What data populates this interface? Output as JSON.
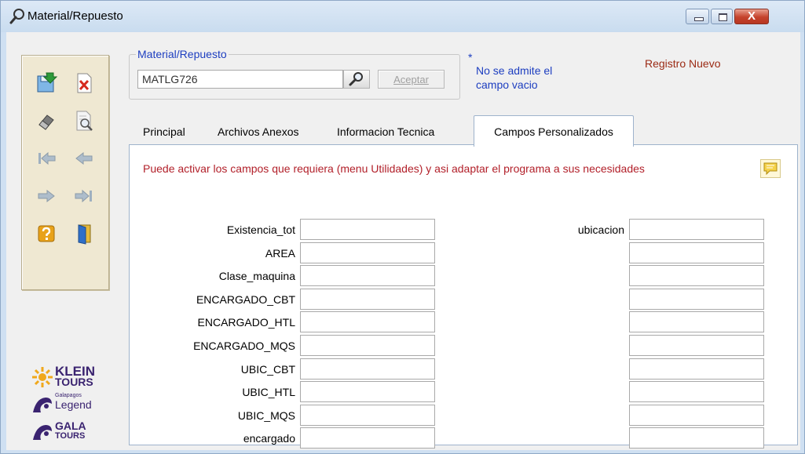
{
  "window": {
    "title": "Material/Repuesto",
    "close_glyph": "X"
  },
  "material": {
    "legend": "Material/Repuesto",
    "value": "MATLG726",
    "accept_label": "Aceptar"
  },
  "note": {
    "asterisk": "*",
    "text": "No se admite el campo vacio"
  },
  "status": "Registro Nuevo",
  "tabs": [
    "Principal",
    "Archivos Anexos",
    "Informacion Tecnica",
    "Campos Personalizados"
  ],
  "panel": {
    "message": "Puede activar los campos que requiera (menu Utilidades) y asi adaptar el programa a sus necesidades",
    "left_fields": [
      {
        "label": "Existencia_tot",
        "value": ""
      },
      {
        "label": "AREA",
        "value": ""
      },
      {
        "label": "Clase_maquina",
        "value": ""
      },
      {
        "label": "ENCARGADO_CBT",
        "value": ""
      },
      {
        "label": "ENCARGADO_HTL",
        "value": ""
      },
      {
        "label": "ENCARGADO_MQS",
        "value": ""
      },
      {
        "label": "UBIC_CBT",
        "value": ""
      },
      {
        "label": "UBIC_HTL",
        "value": ""
      },
      {
        "label": "UBIC_MQS",
        "value": ""
      },
      {
        "label": "encargado",
        "value": ""
      }
    ],
    "right_fields": [
      {
        "label": "ubicacion",
        "value": ""
      },
      {
        "label": "",
        "value": ""
      },
      {
        "label": "",
        "value": ""
      },
      {
        "label": "",
        "value": ""
      },
      {
        "label": "",
        "value": ""
      },
      {
        "label": "",
        "value": ""
      },
      {
        "label": "",
        "value": ""
      },
      {
        "label": "",
        "value": ""
      },
      {
        "label": "",
        "value": ""
      },
      {
        "label": "",
        "value": ""
      }
    ]
  },
  "toolbar": {
    "buttons": [
      {
        "name": "save-icon",
        "color": "#2e9a3a"
      },
      {
        "name": "cancel-icon",
        "color": "#d62a1e"
      },
      {
        "name": "eraser-icon",
        "color": "#6b6b6b"
      },
      {
        "name": "preview-icon",
        "color": "#7a7a7a"
      },
      {
        "name": "first-record-icon",
        "color": "#9fb0c0"
      },
      {
        "name": "previous-record-icon",
        "color": "#9fb0c0"
      },
      {
        "name": "next-record-icon",
        "color": "#9fb0c0"
      },
      {
        "name": "last-record-icon",
        "color": "#9fb0c0"
      },
      {
        "name": "help-icon",
        "color": "#e8a21a"
      },
      {
        "name": "exit-icon",
        "color": "#2f6fc8"
      }
    ]
  },
  "logos": {
    "klein_line1": "KLEIN",
    "klein_line2": "TOURS",
    "legend_line1": "Galapagos",
    "legend_line2": "Legend",
    "gala_line1": "GALA",
    "gala_line2": "TOURS"
  },
  "colors": {
    "accent_blue": "#1d3ec0",
    "message_red": "#b2202a",
    "status_brown": "#9b2a14",
    "logo_purple": "#3a2370",
    "logo_orange": "#f0a81c"
  }
}
